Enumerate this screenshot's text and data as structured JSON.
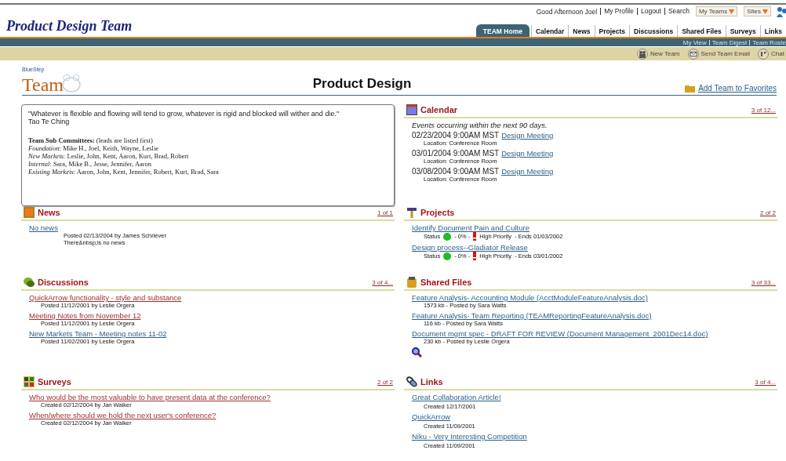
{
  "header": {
    "greeting": "Good Afternoon Joel",
    "links": [
      "My Profile",
      "Logout",
      "Search"
    ],
    "menus": [
      "My Teams",
      "Sites"
    ]
  },
  "site_title": "Product Design Team",
  "tabs": [
    {
      "label": "TEAM Home",
      "selected": true
    },
    {
      "label": "Calendar",
      "selected": false
    },
    {
      "label": "News",
      "selected": false
    },
    {
      "label": "Projects",
      "selected": false
    },
    {
      "label": "Discussions",
      "selected": false
    },
    {
      "label": "Shared Files",
      "selected": false
    },
    {
      "label": "Surveys",
      "selected": false
    },
    {
      "label": "Links",
      "selected": false
    }
  ],
  "subnav": [
    "My View",
    "Team Digest",
    "Team Roste"
  ],
  "toolbar": [
    {
      "kind": "team",
      "label": "New Team"
    },
    {
      "kind": "email",
      "label": "Send Team Email"
    },
    {
      "kind": "chat",
      "label": "Chat"
    }
  ],
  "logo": {
    "small": "BlueStep",
    "text": "Team"
  },
  "page_title": "Product Design",
  "favorites": "Add Team to Favorites",
  "intro_panel": {
    "quote": "\"Whatever is flexible and flowing will tend to grow, whatever is rigid and blocked will wither and die.\"",
    "author": "Tao Te Ching",
    "heading": "**Team Sub Committees:** (leads are listed first)",
    "lines": [
      "*Foundation*: Mike H., Joel, Keith, Wayne, Leslie",
      "*New Markets*: Leslie, John, Kent, Aaron, Kurt, Brad, Robert",
      "*Internal*: Sara, Mike B., Jesse, Jennifer, Aaron",
      "*Existing Markets*: Aaron, John, Kent, Jennifer, Robert, Kurt, Brad, Sara"
    ]
  },
  "sections": [
    {
      "kind": "calendar",
      "title": "Calendar",
      "count": "3 of 12...",
      "intro": "Events occurring within the next 90 days.",
      "items": [
        {
          "when": "02/23/2004 9:00AM MST",
          "title": "Design Meeting",
          "detail": "Location: Conference Room"
        },
        {
          "when": "03/01/2004 9:00AM MST",
          "title": "Design Meeting",
          "detail": "Location: Conference Room"
        },
        {
          "when": "03/08/2004 9:00AM MST",
          "title": "Design Meeting",
          "detail": "Location: Conference Room"
        }
      ]
    },
    {
      "kind": "news",
      "title": "News",
      "count": "1 of 1",
      "items": [
        {
          "title": "No news",
          "visited": false,
          "detail": "Posted 02/13/2004 by James Schriever",
          "body": "There&nbsp;is no news"
        }
      ]
    },
    {
      "kind": "projects",
      "title": "Projects",
      "count": "2 of 2",
      "items": [
        {
          "title": "Identify Document Pain and Culture",
          "status_label": "Status",
          "color": "#22bb22",
          "progress": "- 0% -",
          "priority": "High Priority",
          "ends": "- Ends 01/03/2002"
        },
        {
          "title": "Design process--Gladiator Release",
          "status_label": "Status",
          "color": "#22bb22",
          "progress": "- 0% -",
          "priority": "High Priority",
          "ends": "- Ends 03/01/2002"
        }
      ]
    },
    {
      "kind": "discussions",
      "title": "Discussions",
      "count": "3 of 4...",
      "items": [
        {
          "title": "QuickArrow functionality - style and substance",
          "visited": true,
          "detail": "Posted 11/12/2001 by Leslie Orgera"
        },
        {
          "title": "Meeting Notes from November 12",
          "visited": true,
          "detail": "Posted 11/12/2001 by Leslie Orgera"
        },
        {
          "title": "New Markets Team - Meeting notes 11-02",
          "visited": false,
          "detail": "Posted 11/02/2001 by Leslie Orgera"
        }
      ]
    },
    {
      "kind": "files",
      "title": "Shared Files",
      "count": "3 of 33...",
      "items": [
        {
          "title": "Feature Analysis- Accounting Module (AcctModuleFeatureAnalysis.doc)",
          "visited": false,
          "detail": "1573 kb - Posted by Sara Watts"
        },
        {
          "title": "Feature Analysis- Team Reporting (TEAMReportingFeatureAnalysis.doc)",
          "visited": false,
          "detail": "116 kb - Posted by Sara Watts"
        },
        {
          "title": "Document mgmt spec - DRAFT FOR REVIEW (Document Management_2001Dec14.doc)",
          "visited": false,
          "detail": "230 kb - Posted by Leslie Orgera"
        }
      ]
    },
    {
      "kind": "surveys",
      "title": "Surveys",
      "count": "2 of 2",
      "items": [
        {
          "title": "Who would be the most valuable to have present data at the conference?",
          "visited": true,
          "detail": "Created 02/12/2004 by Jan Walker"
        },
        {
          "title": "When/where should we hold the next user's conference?",
          "visited": true,
          "detail": "Created 02/12/2004 by Jan Walker"
        }
      ]
    },
    {
      "kind": "links",
      "title": "Links",
      "count": "3 of 4...",
      "items": [
        {
          "title": "Great Collaboration Article!",
          "visited": false,
          "detail": "Created 12/17/2001"
        },
        {
          "title": "QuickArrow",
          "visited": false,
          "detail": "Created 11/09/2001"
        },
        {
          "title": "Niku - Very Interesting Competition",
          "visited": false,
          "detail": "Created 11/09/2001"
        }
      ]
    }
  ]
}
